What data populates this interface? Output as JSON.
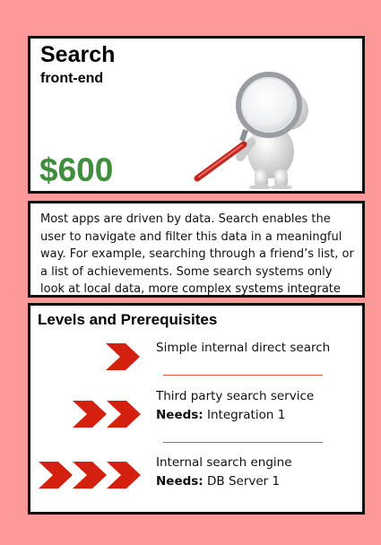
{
  "card": {
    "title": "Search",
    "subtitle": "front-end",
    "price": "$600",
    "price_color": "#3f8e3c",
    "background_color": "#fd9a99",
    "figure_icon": "magnifying-glass-figure-icon"
  },
  "description": {
    "text": "Most apps are driven by data. Search enables the user to navigate and filter this data in a meaningful way. For example, searching through a friend’s list, or a list of achievements. Some search systems only look at local data,  more complex systems integrate external data."
  },
  "levels": {
    "title": "Levels and Prerequisites",
    "chevron_color": "#d4210f",
    "items": [
      {
        "name": "Simple internal direct search",
        "needs_label": "",
        "needs_value": "",
        "level": 1
      },
      {
        "name": "Third party search service",
        "needs_label": "Needs:",
        "needs_value": "Integration 1",
        "level": 2
      },
      {
        "name": "Internal search engine",
        "needs_label": "Needs:",
        "needs_value": "DB Server 1",
        "level": 3
      }
    ]
  }
}
